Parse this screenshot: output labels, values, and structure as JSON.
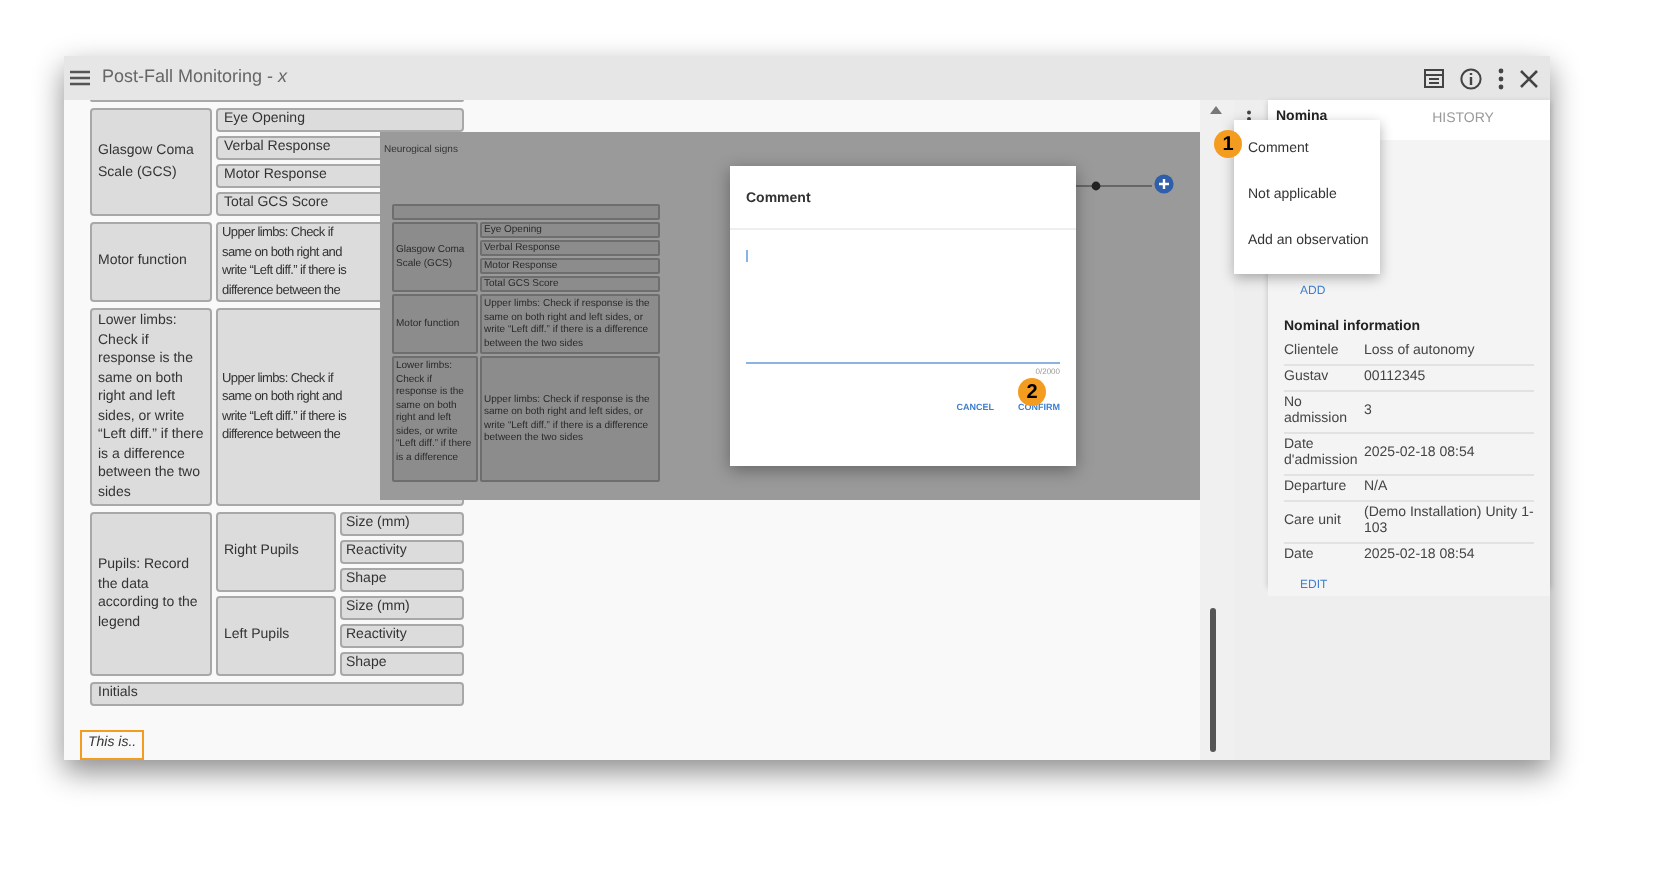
{
  "window": {
    "title": "Post-Fall Monitoring - *x*"
  },
  "form": {
    "gcs": {
      "label": "Glasgow Coma Scale (GCS)",
      "items": [
        "Eye Opening",
        "Verbal Response",
        "Motor Response",
        "Total GCS Score"
      ]
    },
    "motor": {
      "label": "Motor function",
      "lines": [
        "Upper limbs: Check if",
        "same on both right and",
        "write “Left diff.” if there is",
        "difference between the"
      ]
    },
    "lower": {
      "label": "Lower limbs: Check if response is the same on both right and left sides, or write “Left diff.” if there is a difference between the two sides",
      "lines": [
        "Upper limbs: Check if",
        "same on both right and",
        "write “Left diff.” if there is",
        "difference between the"
      ]
    },
    "pupils": {
      "label": "Pupils: Record the data according to the legend",
      "groups": [
        {
          "label": "Right Pupils",
          "items": [
            "Size (mm)",
            "Reactivity",
            "Shape"
          ]
        },
        {
          "label": "Left Pupils",
          "items": [
            "Size (mm)",
            "Reactivity",
            "Shape"
          ]
        }
      ]
    },
    "initials": "Initials",
    "note": "This is.."
  },
  "overlay": {
    "title": "Neurogical signs",
    "gcs": {
      "label": "Glasgow Coma Scale (GCS)",
      "items": [
        "Eye Opening",
        "Verbal Response",
        "Motor Response",
        "Total GCS Score"
      ]
    },
    "motor": {
      "label": "Motor function",
      "text": "Upper limbs: Check if response is the same on both right and left sides, or write “Left diff.” if there is a difference between the two sides"
    },
    "lower": {
      "label": "Lower limbs: Check if response is the same on both right and left sides, or write “Left diff.” if there is a difference",
      "text": "Upper limbs: Check if response is the same on both right and left sides, or write “Left diff.” if there is a difference between the two sides"
    }
  },
  "dialog": {
    "title": "Comment",
    "counter": "0/2000",
    "buttons": [
      "CANCEL",
      "CONFIRM"
    ]
  },
  "markers": [
    "1",
    "2"
  ],
  "menu": {
    "items": [
      "Comment",
      "Not applicable",
      "Add an observation"
    ]
  },
  "side_panel": {
    "tabs": [
      {
        "label": "Nomina",
        "selected": true
      },
      {
        "label": "HISTORY",
        "selected": false
      }
    ],
    "add": "ADD",
    "section_title": "Nominal information",
    "rows": [
      {
        "label": "Clientele",
        "value": "Loss of autonomy"
      },
      {
        "label": "Gustav",
        "value": "00112345"
      },
      {
        "label": "No admission",
        "value": "3"
      },
      {
        "label": "Date d'admission",
        "value": "2025-02-18 08:54"
      },
      {
        "label": "Departure",
        "value": "N/A"
      },
      {
        "label": "Care unit",
        "value": "(Demo Installation) Unity 1-103"
      },
      {
        "label": "Date",
        "value": "2025-02-18 08:54"
      }
    ],
    "edit": "EDIT"
  }
}
